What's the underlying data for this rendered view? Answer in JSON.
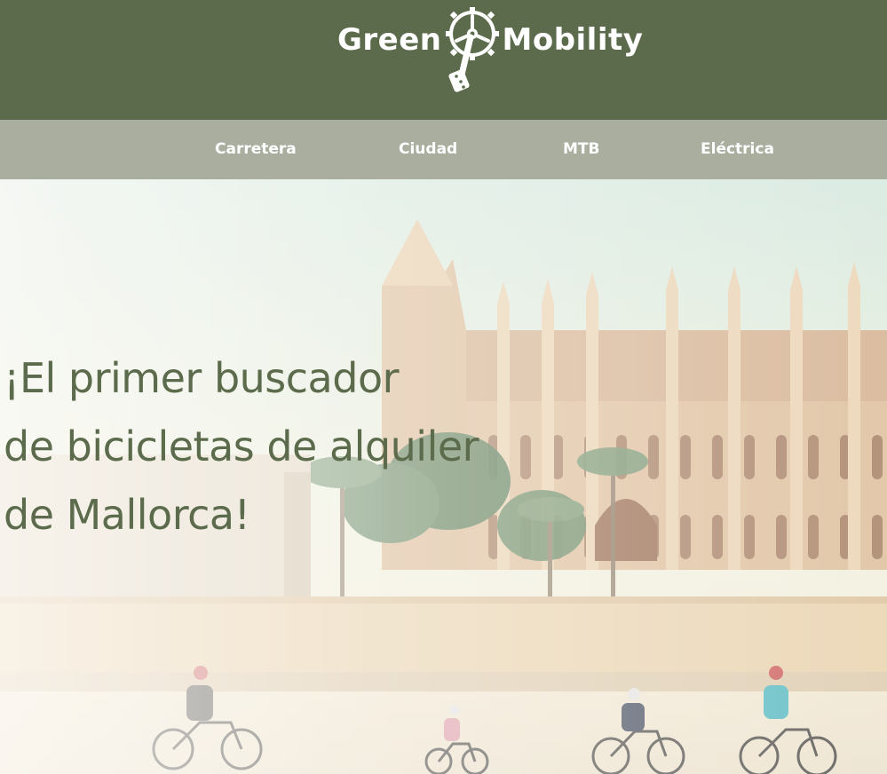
{
  "brand": {
    "left_word": "Green",
    "right_word": "Mobility",
    "logo_icon": "bike-crank-gear-icon",
    "color_dark_green": "#5b6b4b",
    "color_nav_grey": "#a9ae9f"
  },
  "nav": {
    "items": [
      {
        "label": "Carretera"
      },
      {
        "label": "Ciudad"
      },
      {
        "label": "MTB"
      },
      {
        "label": "Eléctrica"
      }
    ]
  },
  "hero": {
    "headline_lines": [
      "¡El primer buscador",
      "de bicicletas de alquiler",
      "de Mallorca!"
    ]
  }
}
